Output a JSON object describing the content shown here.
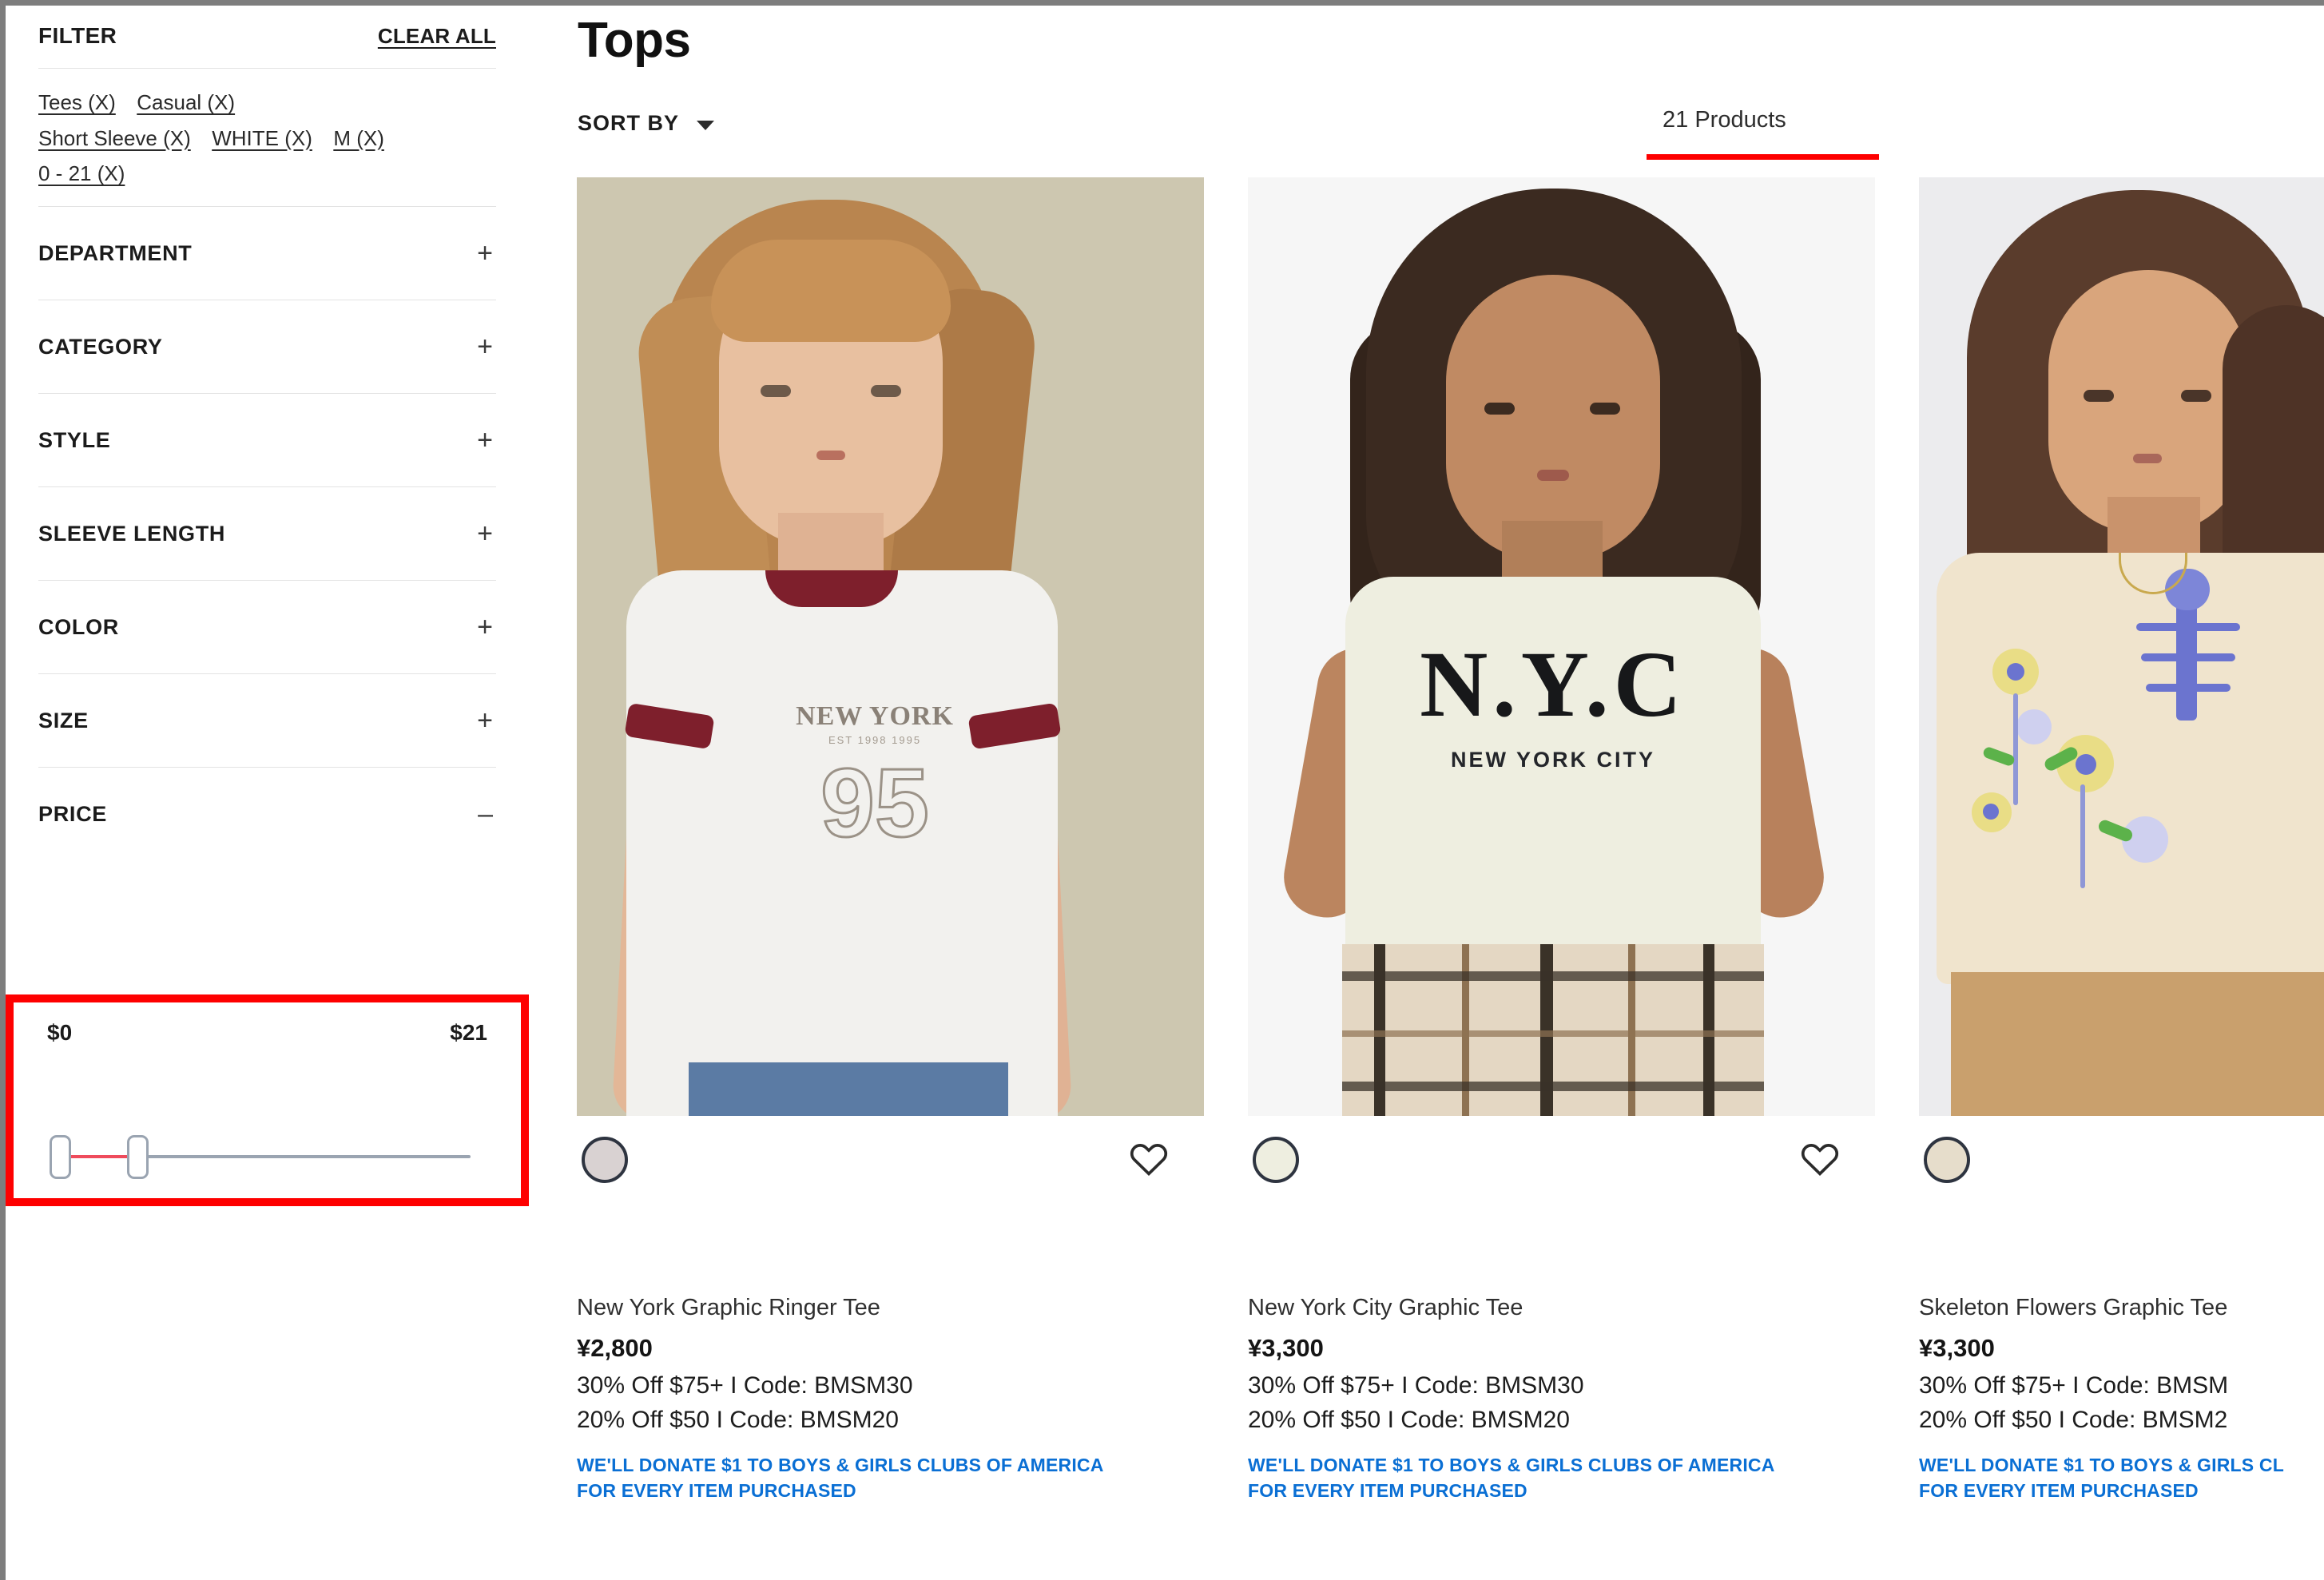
{
  "sidebar": {
    "filter_title": "FILTER",
    "clear_all": "CLEAR ALL",
    "active_filters": [
      {
        "label": "Tees (X)"
      },
      {
        "label": "Casual (X)"
      },
      {
        "label": "Short Sleeve (X)"
      },
      {
        "label": "WHITE (X)"
      },
      {
        "label": "M (X)"
      },
      {
        "label": "0 - 21 (X)"
      }
    ],
    "accordions": [
      {
        "label": "DEPARTMENT",
        "sign": "+",
        "expanded": false
      },
      {
        "label": "CATEGORY",
        "sign": "+",
        "expanded": false
      },
      {
        "label": "STYLE",
        "sign": "+",
        "expanded": false
      },
      {
        "label": "SLEEVE LENGTH",
        "sign": "+",
        "expanded": false
      },
      {
        "label": "COLOR",
        "sign": "+",
        "expanded": false
      },
      {
        "label": "SIZE",
        "sign": "+",
        "expanded": false
      },
      {
        "label": "PRICE",
        "sign": "–",
        "expanded": true
      }
    ],
    "price": {
      "min_label": "$0",
      "max_label": "$21",
      "min_value": 0,
      "max_value": 21,
      "handle_low_pct": 0,
      "handle_high_pct": 19,
      "active_color": "#ef4b5c",
      "track_color": "#9aa4b1",
      "highlight_color": "#fe0000"
    }
  },
  "main": {
    "page_title": "Tops",
    "sort_by_label": "SORT BY",
    "products_count_label": "21 Products",
    "count_underline_color": "#fe0000",
    "products": [
      {
        "name": "New York Graphic Ringer Tee",
        "price": "¥2,800",
        "promo_1": "30% Off $75+ I Code: BMSM30",
        "promo_2": "20% Off $50 I Code: BMSM20",
        "donate_line_1": "WE'LL DONATE $1 TO BOYS & GIRLS CLUBS OF AMERICA",
        "donate_line_2": "FOR EVERY ITEM PURCHASED",
        "swatch_color": "#d9d2d2",
        "image_bg": "#cdc7b0",
        "graphic_top": "NEW YORK",
        "graphic_sub": "EST 1998 1995",
        "graphic_number": "95"
      },
      {
        "name": "New York City Graphic Tee",
        "price": "¥3,300",
        "promo_1": "30% Off $75+ I Code: BMSM30",
        "promo_2": "20% Off $50 I Code: BMSM20",
        "donate_line_1": "WE'LL DONATE $1 TO BOYS & GIRLS CLUBS OF AMERICA",
        "donate_line_2": "FOR EVERY ITEM PURCHASED",
        "swatch_color": "#eeeee0",
        "image_bg": "#f6f6f6",
        "graphic_top": "N.Y.C",
        "graphic_sub": "NEW YORK CITY"
      },
      {
        "name": "Skeleton Flowers Graphic Tee",
        "price": "¥3,300",
        "promo_1": "30% Off $75+ I Code: BMSM",
        "promo_2": "20% Off $50 I Code: BMSM2",
        "donate_line_1": "WE'LL DONATE $1 TO BOYS & GIRLS CL",
        "donate_line_2": "FOR EVERY ITEM PURCHASED",
        "swatch_color": "#e6ddcb",
        "image_bg": "#ececee"
      }
    ]
  }
}
